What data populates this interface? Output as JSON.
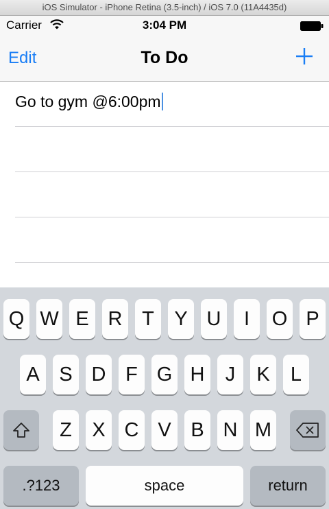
{
  "window": {
    "title": "iOS Simulator - iPhone Retina (3.5-inch) / iOS 7.0 (11A4435d)"
  },
  "status_bar": {
    "carrier": "Carrier",
    "time": "3:04 PM"
  },
  "nav": {
    "edit_label": "Edit",
    "title": "To Do",
    "add_icon": "plus-icon"
  },
  "todos": [
    {
      "text": "Go to gym @6:00pm"
    },
    {
      "text": ""
    },
    {
      "text": ""
    },
    {
      "text": ""
    }
  ],
  "keyboard": {
    "row1": [
      "Q",
      "W",
      "E",
      "R",
      "T",
      "Y",
      "U",
      "I",
      "O",
      "P"
    ],
    "row2": [
      "A",
      "S",
      "D",
      "F",
      "G",
      "H",
      "J",
      "K",
      "L"
    ],
    "row3": [
      "Z",
      "X",
      "C",
      "V",
      "B",
      "N",
      "M"
    ],
    "shift_icon": "shift-icon",
    "delete_icon": "delete-icon",
    "numbers_label": ".?123",
    "space_label": "space",
    "return_label": "return"
  },
  "colors": {
    "accent": "#1a7ef5",
    "keyboard_bg": "#d3d7dc",
    "key": "#fdfdfd",
    "dark_key": "#b4bac1"
  }
}
